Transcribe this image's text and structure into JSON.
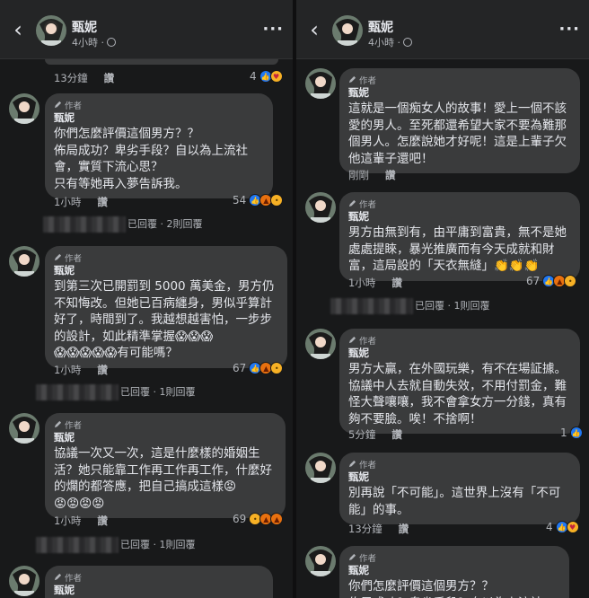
{
  "header": {
    "name": "甄妮",
    "time": "4小時",
    "dot": "·",
    "more": "···",
    "back": "‹"
  },
  "labels": {
    "author": "作者",
    "like": "讚"
  },
  "left": {
    "top_meta": {
      "time": "13分鐘",
      "like": "讚",
      "count": "4",
      "reactions": [
        "like-icon",
        "care-icon"
      ]
    },
    "comments": [
      {
        "name": "甄妮",
        "text": "你們怎麼評價這個男方？？\n佈局成功？卑劣手段？自以為上流社會，實質下流心思？\n只有等她再入夢告訴我。",
        "time": "1小時",
        "count": "54",
        "reactions": [
          "like-icon",
          "angry-icon",
          "sad-icon"
        ],
        "reply": "已回覆 · 2則回覆"
      },
      {
        "name": "甄妮",
        "text": "到第三次已開罰到 5000 萬美金，男方仍不知悔改。但她已百病纏身，男似乎算計好了，時間到了。我越想越害怕，一步步的設計，如此精準掌握😱😱😱\n😱😱😱😱😱有可能嗎？",
        "time": "1小時",
        "count": "67",
        "reactions": [
          "like-icon",
          "angry-icon",
          "sad-icon"
        ],
        "reply": "已回覆 · 1則回覆"
      },
      {
        "name": "甄妮",
        "text": "協議一次又一次，這是什麼樣的婚姻生活？她只能靠工作再工作再工作，什麼好的爛的都答應，把自己搞成這樣😡\n😡😡😡😡",
        "time": "1小時",
        "count": "69",
        "reactions": [
          "sad-icon",
          "angry-icon",
          "angry-icon"
        ],
        "reply": "已回覆 · 1則回覆"
      },
      {
        "name": "甄妮"
      }
    ]
  },
  "right": {
    "comments": [
      {
        "name": "甄妮",
        "text": "這就是一個痴女人的故事！愛上一個不該愛的男人。至死都還希望大家不要為難那個男人。怎麼說她才好呢！這是上輩子欠他這輩子還吧！",
        "time": "剛剛",
        "count": "",
        "reactions": []
      },
      {
        "name": "甄妮",
        "text": "男方由無到有，由平庸到富貴，無不是她處處提睞，暴光推廣而有今天成就和財富，這局設的「天衣無縫」👏👏👏",
        "time": "1小時",
        "count": "67",
        "reactions": [
          "like-icon",
          "angry-icon",
          "sad-icon"
        ],
        "reply": "已回覆 · 1則回覆"
      },
      {
        "name": "甄妮",
        "text": "男方大贏，在外國玩樂，有不在場証據。協議中人去就自動失效，不用付罰金，難怪大聲嚷嚷，我不會拿女方一分錢，真有夠不要臉。唉！不捨啊！",
        "time": "5分鐘",
        "count": "1",
        "reactions": [
          "like-icon"
        ]
      },
      {
        "name": "甄妮",
        "text": "別再說「不可能」。這世界上沒有「不可能」的事。",
        "time": "13分鐘",
        "count": "4",
        "reactions": [
          "like-icon",
          "care-icon"
        ]
      },
      {
        "name": "甄妮",
        "text": "你們怎麼評價這個男方？？\n佈局成功？卑劣手段？自以為上流社"
      }
    ]
  },
  "colors": {
    "background": "#18191a",
    "bubble": "#3a3b3c",
    "text": "#e4e6eb",
    "muted": "#b0b3b8",
    "like": "#2078f4"
  }
}
